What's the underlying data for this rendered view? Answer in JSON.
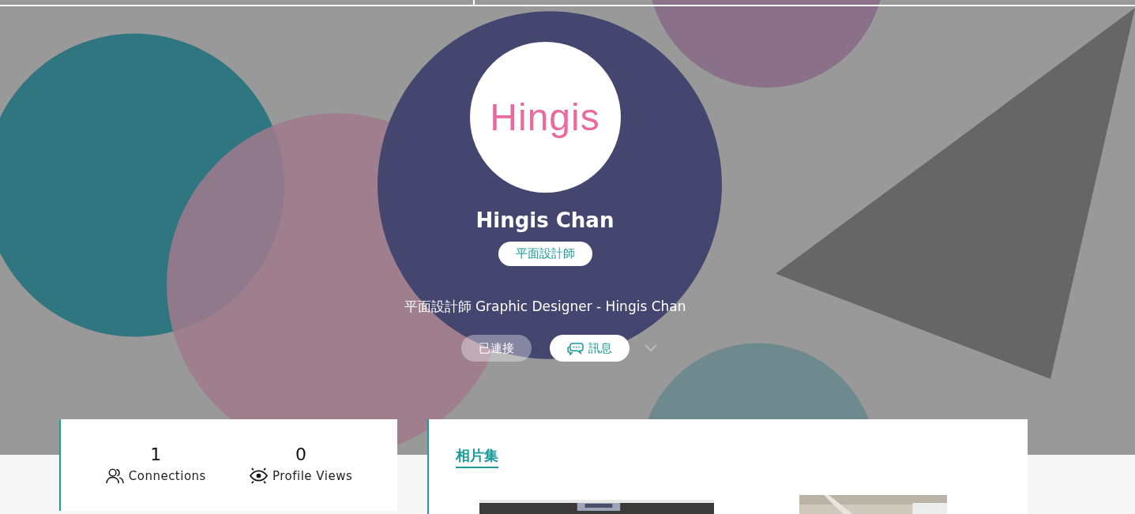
{
  "profile": {
    "avatar_logo": "Hingis",
    "name": "Hingis Chan",
    "tag": "平面設計師",
    "headline": "平面設計師 Graphic Designer - Hingis Chan"
  },
  "actions": [
    {
      "kind": "connected",
      "label": "已連接"
    },
    {
      "kind": "message",
      "label": "訊息"
    }
  ],
  "stats": [
    {
      "kind": "connections",
      "value": "1",
      "label": "Connections"
    },
    {
      "kind": "views",
      "value": "0",
      "label": "Profile Views"
    }
  ],
  "gallery": {
    "title": "相片集"
  }
}
